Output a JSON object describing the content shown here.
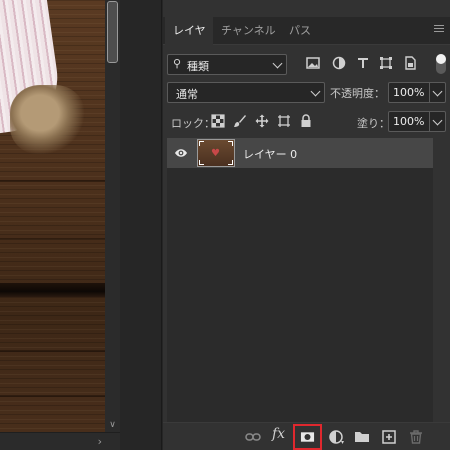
{
  "panel": {
    "tabs": [
      {
        "label": "レイヤー",
        "active": true
      },
      {
        "label": "チャンネル",
        "active": false
      },
      {
        "label": "パス",
        "active": false
      }
    ],
    "menu_icon": "hamburger-menu-icon"
  },
  "filter": {
    "kind_label": "種類",
    "icons": [
      "image-filter-icon",
      "adjustment-filter-icon",
      "type-filter-icon",
      "shape-filter-icon",
      "smart-object-filter-icon"
    ]
  },
  "blend": {
    "mode": "通常",
    "opacity_label": "不透明度：",
    "opacity_value": "100%",
    "fill_label": "塗り：",
    "fill_value": "100%"
  },
  "lock": {
    "label": "ロック：",
    "icons": [
      "lock-transparent-pixels-icon",
      "lock-image-pixels-icon",
      "lock-position-icon",
      "lock-artboard-icon",
      "lock-all-icon"
    ]
  },
  "layers": [
    {
      "name": "レイヤー 0",
      "visible": true,
      "selected": true
    }
  ],
  "bottom_icons": [
    "link-layers-icon",
    "fx-icon",
    "add-mask-icon",
    "adjustment-layer-icon",
    "group-folder-icon",
    "new-layer-icon",
    "delete-layer-icon"
  ],
  "bottom_fx_label": "fx",
  "colors": {
    "panel_bg": "#323232",
    "highlight": "#e0282e",
    "selected_row": "#474747"
  }
}
